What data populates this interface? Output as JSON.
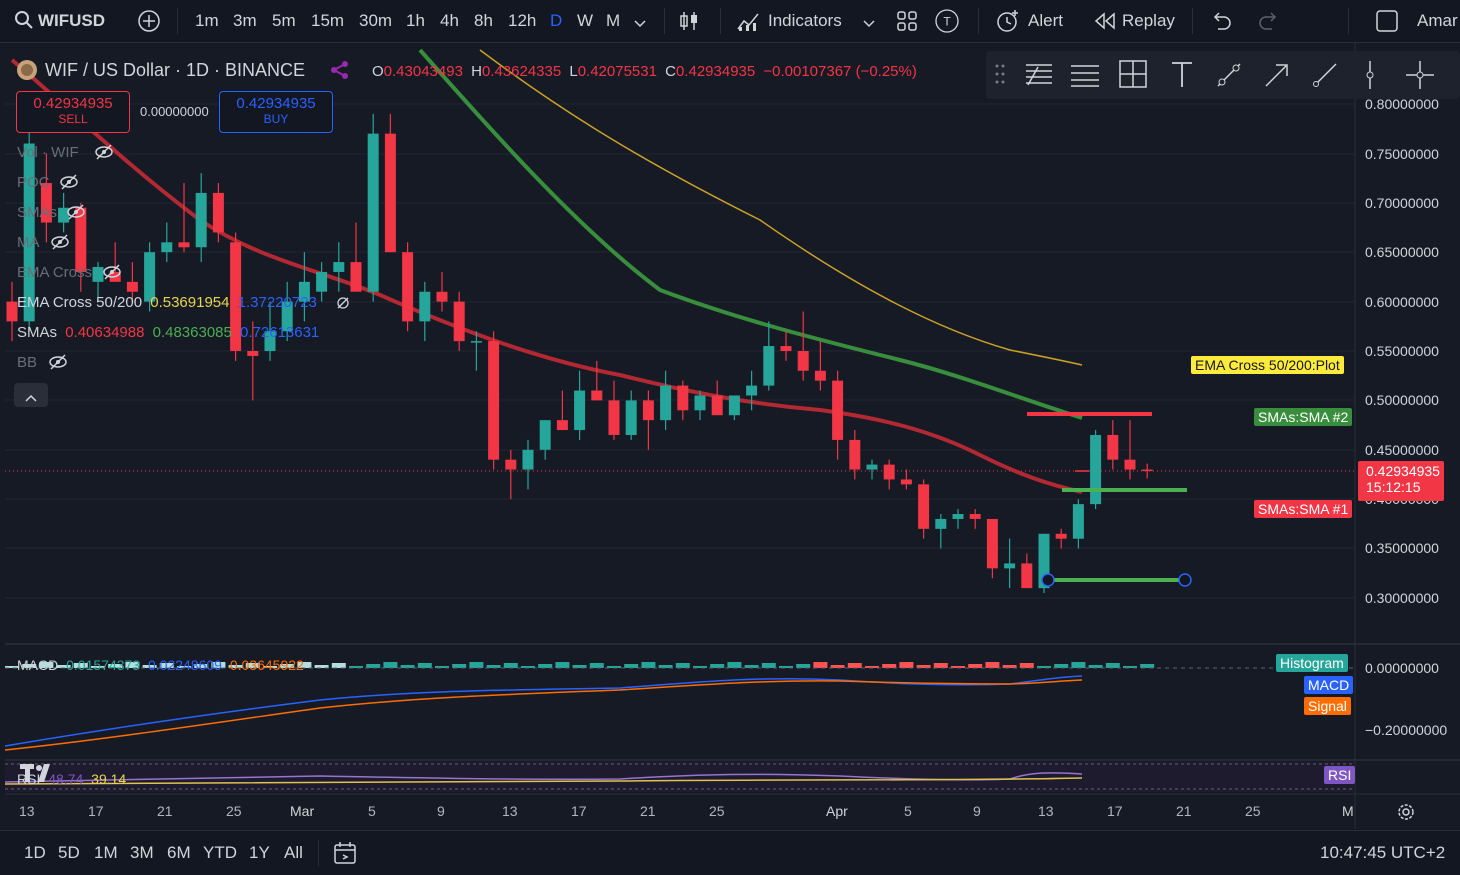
{
  "topbar": {
    "symbol": "WIFUSD",
    "intervals": [
      "1m",
      "3m",
      "5m",
      "15m",
      "30m",
      "1h",
      "4h",
      "8h",
      "12h",
      "D",
      "W",
      "M"
    ],
    "active_interval": "D",
    "indicators_label": "Indicators",
    "alert_label": "Alert",
    "replay_label": "Replay",
    "user_label": "Amar"
  },
  "legend": {
    "title": "WIF / US Dollar · 1D · BINANCE",
    "o_label": "O",
    "o": "0.43043493",
    "h_label": "H",
    "h": "0.43624335",
    "l_label": "L",
    "l": "0.42075531",
    "c_label": "C",
    "c": "0.42934935",
    "change": "−0.00107367 (−0.25%)",
    "sell_price": "0.42934935",
    "sell_label": "SELL",
    "spread": "0.00000000",
    "buy_price": "0.42934935",
    "buy_label": "BUY",
    "vol_label": "Vol · WIF",
    "poc_label": "POC",
    "smas_hidden_label": "SMAs",
    "ma_label": "MA",
    "ema_cross_hidden_label": "EMA Cross",
    "ema_cross_label": "EMA Cross 50/200",
    "ema_cross_v1": "0.53691954",
    "ema_cross_v2": "1.37220723",
    "smas_label": "SMAs",
    "sma_v1": "0.40634988",
    "sma_v2": "0.48363085",
    "sma_v3": "0.72613631",
    "bb_label": "BB"
  },
  "price_axis": [
    "0.80000000",
    "0.75000000",
    "0.70000000",
    "0.65000000",
    "0.60000000",
    "0.55000000",
    "0.50000000",
    "0.45000000",
    "0.40000000",
    "0.35000000",
    "0.30000000"
  ],
  "macd_axis": [
    "0.00000000",
    "−0.20000000"
  ],
  "tags": {
    "ema_plot": "EMA Cross 50/200:Plot",
    "sma2": "SMAs:SMA #2",
    "sma1": "SMAs:SMA #1",
    "last_price": "0.42934935",
    "countdown": "15:12:15",
    "histogram": "Histogram",
    "macd": "MACD",
    "signal": "Signal",
    "rsi": "RSI"
  },
  "macd_legend": {
    "label": "MACD",
    "v1": "0.01574373",
    "v2": "0.02248609",
    "v3": "0.03645922"
  },
  "rsi_legend": {
    "label": "RSI",
    "v1": "48.74",
    "v2": "39.14"
  },
  "x_axis": [
    "13",
    "17",
    "21",
    "25",
    "Mar",
    "5",
    "9",
    "13",
    "17",
    "21",
    "25",
    "Apr",
    "5",
    "9",
    "13",
    "17",
    "21",
    "25",
    "M"
  ],
  "bottombar": {
    "ranges": [
      "1D",
      "5D",
      "1M",
      "3M",
      "6M",
      "YTD",
      "1Y",
      "All"
    ],
    "clock": "10:47:45 UTC+2"
  },
  "colors": {
    "up": "#26a69a",
    "down": "#f23645",
    "accent": "#2962ff",
    "sma_red": "#b22833",
    "sma_green": "#388e3c",
    "ema_yellow": "#c9a227"
  },
  "chart_data": {
    "type": "candlestick",
    "x_labels": [
      "13",
      "17",
      "21",
      "25",
      "Mar",
      "5",
      "9",
      "13",
      "17",
      "21",
      "25",
      "Apr",
      "5",
      "9",
      "13",
      "17",
      "21",
      "25"
    ],
    "ohlc": [
      [
        0.6,
        0.62,
        0.56,
        0.58
      ],
      [
        0.58,
        0.79,
        0.57,
        0.76
      ],
      [
        0.72,
        0.75,
        0.66,
        0.68
      ],
      [
        0.68,
        0.71,
        0.67,
        0.695
      ],
      [
        0.695,
        0.7,
        0.61,
        0.63
      ],
      [
        0.62,
        0.64,
        0.6,
        0.635
      ],
      [
        0.63,
        0.66,
        0.62,
        0.62
      ],
      [
        0.62,
        0.64,
        0.6,
        0.61
      ],
      [
        0.6,
        0.66,
        0.59,
        0.65
      ],
      [
        0.65,
        0.68,
        0.64,
        0.66
      ],
      [
        0.66,
        0.72,
        0.65,
        0.655
      ],
      [
        0.655,
        0.73,
        0.64,
        0.71
      ],
      [
        0.71,
        0.72,
        0.66,
        0.67
      ],
      [
        0.66,
        0.67,
        0.54,
        0.55
      ],
      [
        0.55,
        0.58,
        0.5,
        0.545
      ],
      [
        0.55,
        0.6,
        0.54,
        0.57
      ],
      [
        0.57,
        0.62,
        0.56,
        0.6
      ],
      [
        0.6,
        0.65,
        0.58,
        0.62
      ],
      [
        0.61,
        0.64,
        0.6,
        0.63
      ],
      [
        0.63,
        0.66,
        0.61,
        0.64
      ],
      [
        0.64,
        0.68,
        0.62,
        0.61
      ],
      [
        0.61,
        0.79,
        0.6,
        0.77
      ],
      [
        0.77,
        0.79,
        0.65,
        0.65
      ],
      [
        0.65,
        0.66,
        0.57,
        0.58
      ],
      [
        0.58,
        0.62,
        0.56,
        0.61
      ],
      [
        0.61,
        0.63,
        0.59,
        0.6
      ],
      [
        0.6,
        0.61,
        0.55,
        0.56
      ],
      [
        0.56,
        0.57,
        0.53,
        0.56
      ],
      [
        0.56,
        0.57,
        0.43,
        0.44
      ],
      [
        0.44,
        0.45,
        0.4,
        0.43
      ],
      [
        0.43,
        0.46,
        0.41,
        0.45
      ],
      [
        0.45,
        0.48,
        0.44,
        0.48
      ],
      [
        0.48,
        0.51,
        0.47,
        0.47
      ],
      [
        0.47,
        0.53,
        0.46,
        0.51
      ],
      [
        0.51,
        0.54,
        0.5,
        0.5
      ],
      [
        0.5,
        0.52,
        0.46,
        0.465
      ],
      [
        0.465,
        0.51,
        0.46,
        0.5
      ],
      [
        0.5,
        0.51,
        0.45,
        0.48
      ],
      [
        0.48,
        0.53,
        0.47,
        0.515
      ],
      [
        0.515,
        0.52,
        0.48,
        0.49
      ],
      [
        0.49,
        0.51,
        0.48,
        0.505
      ],
      [
        0.505,
        0.52,
        0.49,
        0.485
      ],
      [
        0.485,
        0.5,
        0.48,
        0.505
      ],
      [
        0.505,
        0.53,
        0.49,
        0.515
      ],
      [
        0.515,
        0.58,
        0.51,
        0.555
      ],
      [
        0.555,
        0.57,
        0.54,
        0.55
      ],
      [
        0.55,
        0.59,
        0.52,
        0.53
      ],
      [
        0.53,
        0.56,
        0.51,
        0.52
      ],
      [
        0.52,
        0.53,
        0.44,
        0.46
      ],
      [
        0.46,
        0.47,
        0.42,
        0.43
      ],
      [
        0.43,
        0.44,
        0.42,
        0.435
      ],
      [
        0.435,
        0.44,
        0.41,
        0.42
      ],
      [
        0.42,
        0.43,
        0.41,
        0.415
      ],
      [
        0.415,
        0.42,
        0.36,
        0.37
      ],
      [
        0.37,
        0.385,
        0.35,
        0.38
      ],
      [
        0.38,
        0.39,
        0.37,
        0.385
      ],
      [
        0.385,
        0.39,
        0.37,
        0.38
      ],
      [
        0.38,
        0.38,
        0.32,
        0.33
      ],
      [
        0.33,
        0.36,
        0.31,
        0.335
      ],
      [
        0.335,
        0.345,
        0.31,
        0.31
      ],
      [
        0.31,
        0.365,
        0.305,
        0.365
      ],
      [
        0.365,
        0.37,
        0.35,
        0.36
      ],
      [
        0.36,
        0.4,
        0.35,
        0.395
      ],
      [
        0.395,
        0.47,
        0.39,
        0.465
      ],
      [
        0.465,
        0.48,
        0.43,
        0.44
      ],
      [
        0.44,
        0.48,
        0.42,
        0.43
      ],
      [
        0.43,
        0.436,
        0.421,
        0.429
      ]
    ],
    "ylim": [
      0.28,
      0.82
    ],
    "grid": true
  }
}
